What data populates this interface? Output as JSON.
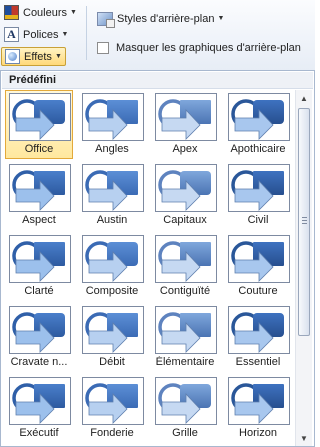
{
  "ribbon": {
    "colors_label": "Couleurs",
    "fonts_label": "Polices",
    "effects_label": "Effets",
    "background_styles_label": "Styles d'arrière-plan",
    "hide_background_label": "Masquer les graphiques d'arrière-plan",
    "hide_background_checked": false
  },
  "panel": {
    "section_title": "Prédéfini",
    "selected_effect": "Office",
    "effects": [
      {
        "label": "Office",
        "icon": "office-effect-icon"
      },
      {
        "label": "Angles",
        "icon": "angles-effect-icon"
      },
      {
        "label": "Apex",
        "icon": "apex-effect-icon"
      },
      {
        "label": "Apothicaire",
        "icon": "apothicaire-effect-icon"
      },
      {
        "label": "Aspect",
        "icon": "aspect-effect-icon"
      },
      {
        "label": "Austin",
        "icon": "austin-effect-icon"
      },
      {
        "label": "Capitaux",
        "icon": "capitaux-effect-icon"
      },
      {
        "label": "Civil",
        "icon": "civil-effect-icon"
      },
      {
        "label": "Clarté",
        "icon": "clarte-effect-icon"
      },
      {
        "label": "Composite",
        "icon": "composite-effect-icon"
      },
      {
        "label": "Contiguïté",
        "icon": "contiguite-effect-icon"
      },
      {
        "label": "Couture",
        "icon": "couture-effect-icon"
      },
      {
        "label": "Cravate n...",
        "icon": "cravate-effect-icon"
      },
      {
        "label": "Débit",
        "icon": "debit-effect-icon"
      },
      {
        "label": "Élémentaire",
        "icon": "elementaire-effect-icon"
      },
      {
        "label": "Essentiel",
        "icon": "essentiel-effect-icon"
      },
      {
        "label": "Exécutif",
        "icon": "executif-effect-icon"
      },
      {
        "label": "Fonderie",
        "icon": "fonderie-effect-icon"
      },
      {
        "label": "Grille",
        "icon": "grille-effect-icon"
      },
      {
        "label": "Horizon",
        "icon": "horizon-effect-icon"
      }
    ]
  },
  "colors": {
    "selected_border": "#e3a93a",
    "selected_fill": "#ffe89f",
    "effect_blue": "#3f77c4",
    "effect_light_blue": "#8fb2e3"
  }
}
